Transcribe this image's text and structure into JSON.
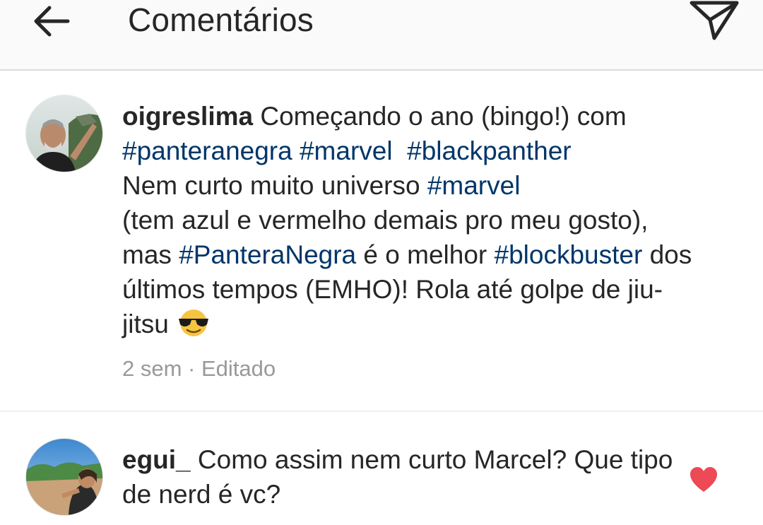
{
  "header": {
    "title": "Comentários",
    "back_icon": "arrow-left-icon",
    "send_icon": "paper-plane-icon"
  },
  "caption": {
    "username": "oigreslima",
    "text_parts": [
      {
        "t": "Começando o ano (bingo!) com ",
        "tag": false
      },
      {
        "t": "#panteranegra",
        "tag": true
      },
      {
        "t": " ",
        "tag": false
      },
      {
        "t": "#marvel",
        "tag": true
      },
      {
        "t": "  ",
        "tag": false
      },
      {
        "t": "#blackpanther",
        "tag": true
      },
      {
        "t": "\nNem curto muito universo ",
        "tag": false
      },
      {
        "t": "#marvel",
        "tag": true
      },
      {
        "t": "\n(tem azul e vermelho demais pro meu gosto), mas ",
        "tag": false
      },
      {
        "t": "#PanteraNegra",
        "tag": true
      },
      {
        "t": " é o melhor ",
        "tag": false
      },
      {
        "t": "#blockbuster",
        "tag": true
      },
      {
        "t": " dos últimos tempos (EMHO)! Rola até golpe de jiu-jitsu ",
        "tag": false
      }
    ],
    "emoji": "sunglasses-face-emoji",
    "time": "2 sem",
    "separator": "·",
    "edited": "Editado"
  },
  "comments": [
    {
      "username": "egui_",
      "text": "Como assim nem curto Marcel? Que tipo de nerd é vc?",
      "liked": true
    }
  ],
  "colors": {
    "hashtag": "#003569",
    "heart": "#ed4956",
    "meta": "#999999",
    "text": "#262626"
  }
}
